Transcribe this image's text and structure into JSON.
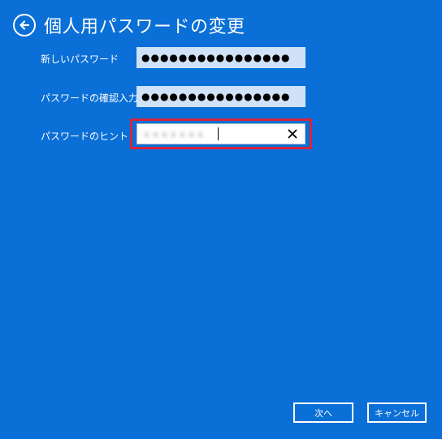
{
  "header": {
    "title": "個人用パスワードの変更"
  },
  "form": {
    "new_password": {
      "label": "新しいパスワード",
      "value": "●●●●●●●●●●●●●●●●"
    },
    "confirm_password": {
      "label": "パスワードの確認入力",
      "value": "●●●●●●●●●●●●●●●●"
    },
    "hint": {
      "label": "パスワードのヒント",
      "value": "ｘｘｘｘｘｘｘ"
    }
  },
  "buttons": {
    "next": "次へ",
    "cancel": "キャンセル"
  },
  "colors": {
    "background": "#0a6fd6",
    "field_filled": "#cfe2f7",
    "highlight": "#d6243d"
  }
}
